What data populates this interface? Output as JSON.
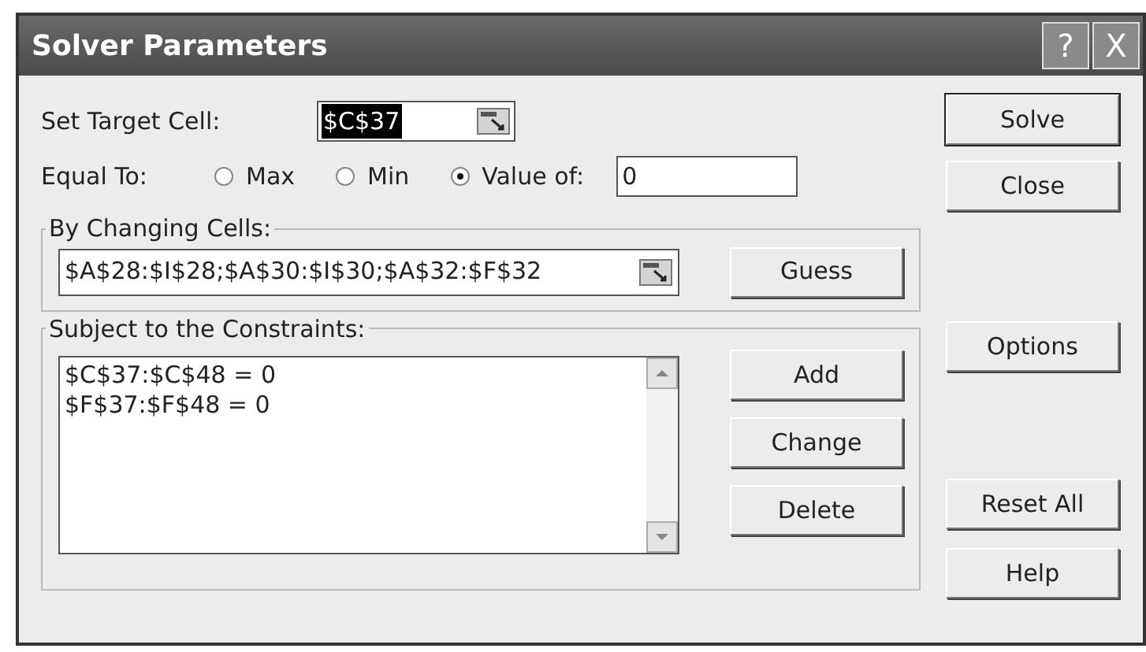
{
  "window": {
    "title": "Solver Parameters",
    "title_buttons": [
      "?",
      "X"
    ]
  },
  "target": {
    "label": "Set Target Cell:",
    "value": "$C$37",
    "selected": true
  },
  "equal_to": {
    "label": "Equal To:",
    "options": [
      {
        "label": "Max",
        "selected": false
      },
      {
        "label": "Min",
        "selected": false
      },
      {
        "label": "Value of:",
        "selected": true
      }
    ],
    "value": "0"
  },
  "changing_cells": {
    "label": "By Changing Cells:",
    "value": "$A$28:$I$28;$A$30:$I$30;$A$32:$F$32",
    "button": "Guess"
  },
  "constraints": {
    "label": "Subject to the Constraints:",
    "items": [
      "$C$37:$C$48 = 0",
      "$F$37:$F$48 = 0"
    ],
    "buttons": [
      "Add",
      "Change",
      "Delete"
    ]
  },
  "side_buttons": [
    {
      "label": "Solve",
      "default": true
    },
    {
      "label": "Close",
      "default": false
    },
    {
      "label": "Options",
      "default": false
    },
    {
      "label": "Reset All",
      "default": false
    },
    {
      "label": "Help",
      "default": false
    }
  ]
}
